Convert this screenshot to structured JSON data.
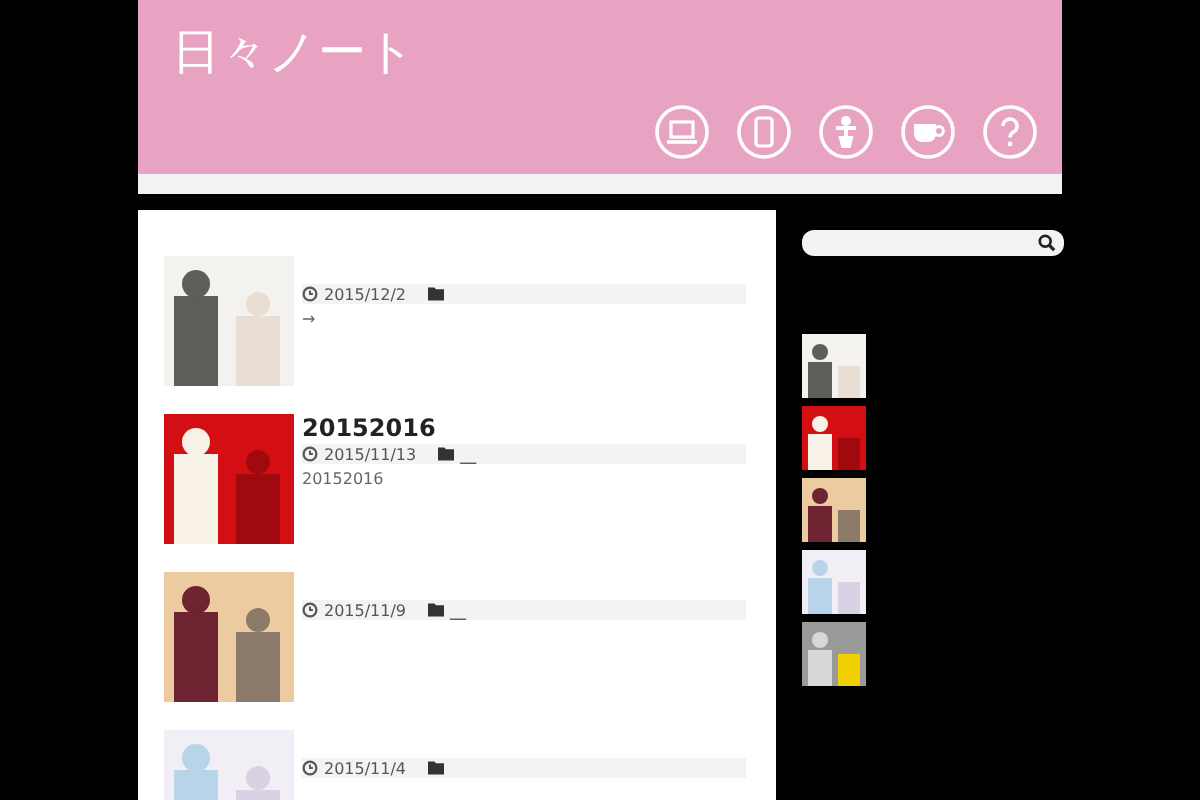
{
  "site": {
    "title": "日々ノート"
  },
  "posts": [
    {
      "date": "2015/12/2",
      "excerpt": "→"
    },
    {
      "title": "20152016",
      "date": "2015/11/13",
      "category": "__",
      "excerpt": "20152016"
    },
    {
      "date": "2015/11/9",
      "category": "__"
    },
    {
      "date": "2015/11/4"
    }
  ]
}
